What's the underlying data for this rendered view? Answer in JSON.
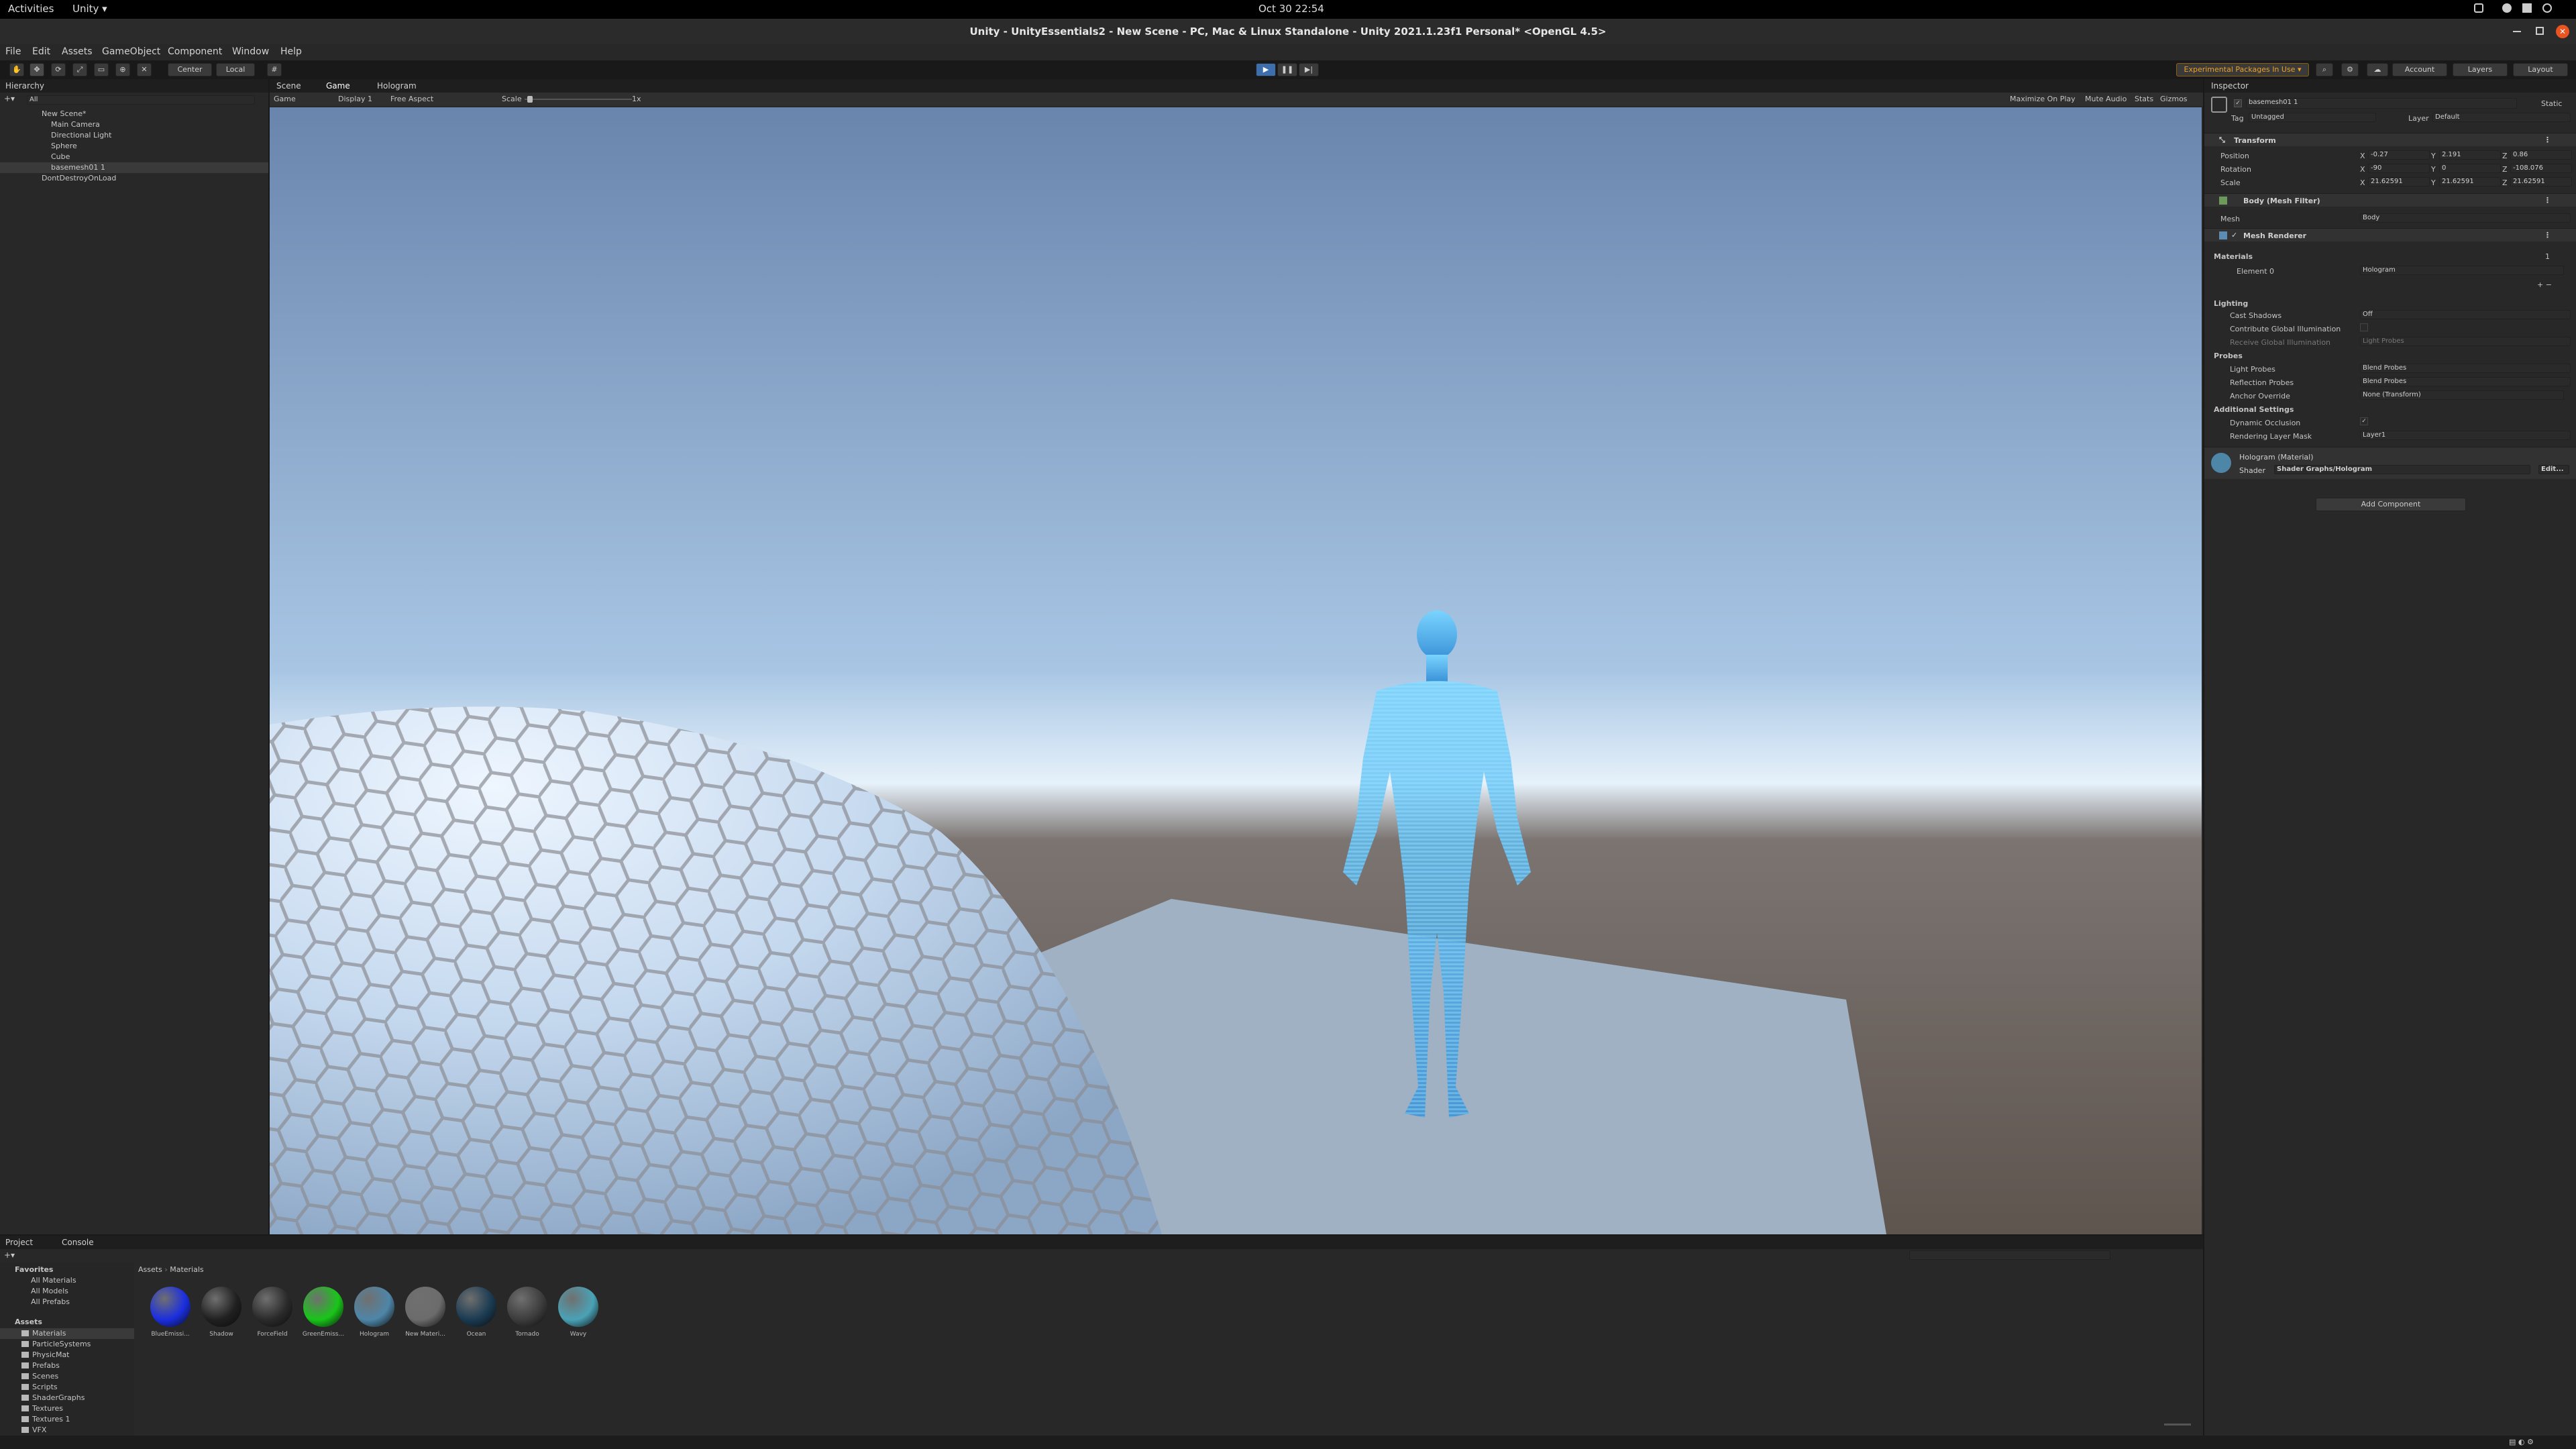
{
  "gnome": {
    "activities": "Activities",
    "app": "Unity ▾",
    "clock": "Oct 30  22:54"
  },
  "window": {
    "title": "Unity - UnityEssentials2 - New Scene - PC, Mac & Linux Standalone - Unity 2021.1.23f1 Personal* <OpenGL 4.5>"
  },
  "menu": [
    "File",
    "Edit",
    "Assets",
    "GameObject",
    "Component",
    "Window",
    "Help"
  ],
  "toolbar": {
    "center": "Center",
    "local": "Local",
    "experimental": "Experimental Packages In Use ▾",
    "account": "Account",
    "layers": "Layers",
    "layout": "Layout"
  },
  "hierarchy": {
    "tab": "Hierarchy",
    "search_placeholder": "All",
    "rows": [
      {
        "label": "New Scene*",
        "indent": 0
      },
      {
        "label": "Main Camera",
        "indent": 1
      },
      {
        "label": "Directional Light",
        "indent": 1
      },
      {
        "label": "Sphere",
        "indent": 1
      },
      {
        "label": "Cube",
        "indent": 1
      },
      {
        "label": "basemesh01 1",
        "indent": 1
      },
      {
        "label": "DontDestroyOnLoad",
        "indent": 0
      }
    ]
  },
  "game": {
    "tabs": [
      "Scene",
      "Game",
      "Hologram"
    ],
    "mode": "Game",
    "display": "Display 1",
    "aspect": "Free Aspect",
    "scale_label": "Scale",
    "scale_value": "1x",
    "options": [
      "Maximize On Play",
      "Mute Audio",
      "Stats",
      "Gizmos"
    ]
  },
  "inspector": {
    "tab": "Inspector",
    "object_name": "basemesh01 1",
    "static": "Static",
    "tag_label": "Tag",
    "tag": "Untagged",
    "layer_label": "Layer",
    "layer": "Default",
    "transform": {
      "title": "Transform",
      "position": {
        "label": "Position",
        "x": "-0.27",
        "y": "2.191",
        "z": "0.86"
      },
      "rotation": {
        "label": "Rotation",
        "x": "-90",
        "y": "0",
        "z": "-108.076"
      },
      "scale": {
        "label": "Scale",
        "x": "21.62591",
        "y": "21.62591",
        "z": "21.62591"
      }
    },
    "mesh_filter": {
      "title": "Body (Mesh Filter)",
      "mesh_label": "Mesh",
      "mesh": "Body"
    },
    "mesh_renderer": {
      "title": "Mesh Renderer",
      "materials_label": "Materials",
      "materials_count": "1",
      "element_label": "Element 0",
      "element": "Hologram",
      "lighting": "Lighting",
      "cast_shadows_label": "Cast Shadows",
      "cast_shadows": "Off",
      "contribute_gi": "Contribute Global Illumination",
      "receive_gi_label": "Receive Global Illumination",
      "receive_gi": "Light Probes",
      "probes": "Probes",
      "light_probes_label": "Light Probes",
      "light_probes": "Blend Probes",
      "reflection_probes_label": "Reflection Probes",
      "reflection_probes": "Blend Probes",
      "anchor_label": "Anchor Override",
      "anchor": "None (Transform)",
      "additional": "Additional Settings",
      "dynamic_occlusion": "Dynamic Occlusion",
      "rendering_layer_label": "Rendering Layer Mask",
      "rendering_layer": "Layer1"
    },
    "material": {
      "title": "Hologram (Material)",
      "shader_label": "Shader",
      "shader": "Shader Graphs/Hologram",
      "edit": "Edit..."
    },
    "add_component": "Add Component"
  },
  "project": {
    "tabs": [
      "Project",
      "Console"
    ],
    "favorites": "Favorites",
    "fav_items": [
      "All Materials",
      "All Models",
      "All Prefabs"
    ],
    "assets": "Assets",
    "folders": [
      "Materials",
      "ParticleSystems",
      "PhysicMat",
      "Prefabs",
      "Scenes",
      "Scripts",
      "ShaderGraphs",
      "Textures",
      "Textures 1",
      "VFX"
    ],
    "breadcrumb": [
      "Assets",
      "Materials"
    ],
    "materials": [
      {
        "name": "BlueEmissi...",
        "color": "#1a2ee0"
      },
      {
        "name": "Shadow",
        "color": "#202020"
      },
      {
        "name": "ForceField",
        "color": "#2a2a2a"
      },
      {
        "name": "GreenEmiss...",
        "color": "#19c519"
      },
      {
        "name": "Hologram",
        "color": "#4e86a8"
      },
      {
        "name": "New Materi...",
        "color": "#6c6c6c"
      },
      {
        "name": "Ocean",
        "color": "#1a3b52"
      },
      {
        "name": "Tornado",
        "color": "#3c3c3c"
      },
      {
        "name": "Wavy",
        "color": "#4aa2b6"
      }
    ]
  }
}
